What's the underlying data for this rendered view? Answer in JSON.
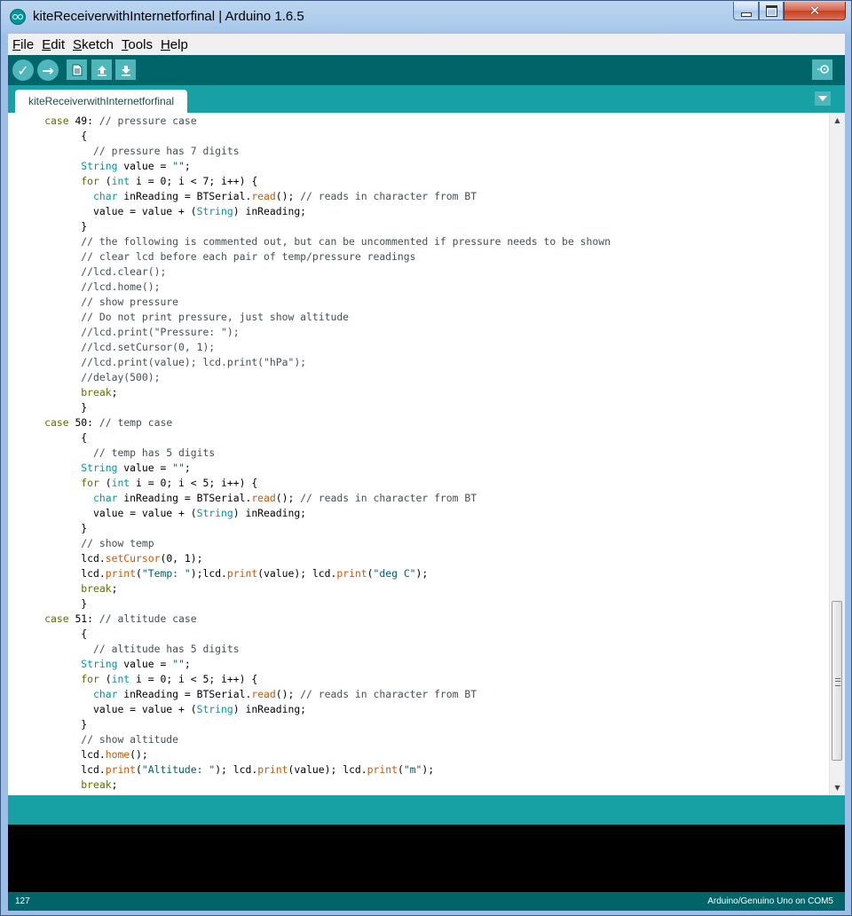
{
  "window": {
    "title": "kiteReceiverwithInternetforfinal | Arduino 1.6.5",
    "minimize_glyph": "",
    "maximize_glyph": "",
    "close_glyph": "✕"
  },
  "menu": {
    "items": [
      {
        "accel": "F",
        "rest": "ile"
      },
      {
        "accel": "E",
        "rest": "dit"
      },
      {
        "accel": "S",
        "rest": "ketch"
      },
      {
        "accel": "T",
        "rest": "ools"
      },
      {
        "accel": "H",
        "rest": "elp"
      }
    ]
  },
  "toolbar": {
    "verify_glyph": "✓",
    "upload_glyph": "→",
    "icons": [
      "verify-icon",
      "upload-icon",
      "new-icon",
      "open-icon",
      "save-icon",
      "serial-monitor-icon"
    ]
  },
  "tabs": {
    "active": "kiteReceiverwithInternetforfinal"
  },
  "editor": {
    "lines": [
      [
        [
          "      ",
          ""
        ],
        [
          "case",
          "kw"
        ],
        [
          " 49: ",
          ""
        ],
        [
          "// pressure case",
          "cm"
        ]
      ],
      [
        [
          "            {",
          ""
        ]
      ],
      [
        [
          "              ",
          ""
        ],
        [
          "// pressure has 7 digits",
          "cm"
        ]
      ],
      [
        [
          "            ",
          ""
        ],
        [
          "String",
          "ty"
        ],
        [
          " value = ",
          ""
        ],
        [
          "\"\"",
          "st"
        ],
        [
          ";",
          ""
        ]
      ],
      [
        [
          "            ",
          ""
        ],
        [
          "for",
          "kw"
        ],
        [
          " (",
          ""
        ],
        [
          "int",
          "ty"
        ],
        [
          " i = 0; i < 7; i++) {",
          ""
        ]
      ],
      [
        [
          "              ",
          ""
        ],
        [
          "char",
          "ty"
        ],
        [
          " inReading = BTSerial.",
          ""
        ],
        [
          "read",
          "fn"
        ],
        [
          "(); ",
          ""
        ],
        [
          "// reads in character from BT",
          "cm"
        ]
      ],
      [
        [
          "              value = value + (",
          ""
        ],
        [
          "String",
          "ty"
        ],
        [
          ") inReading;",
          ""
        ]
      ],
      [
        [
          "            }",
          ""
        ]
      ],
      [
        [
          "            ",
          ""
        ],
        [
          "// the following is commented out, but can be uncommented if pressure needs to be shown",
          "cm"
        ]
      ],
      [
        [
          "            ",
          ""
        ],
        [
          "// clear lcd before each pair of temp/pressure readings",
          "cm"
        ]
      ],
      [
        [
          "            ",
          ""
        ],
        [
          "//lcd.clear();",
          "cm"
        ]
      ],
      [
        [
          "            ",
          ""
        ],
        [
          "//lcd.home();",
          "cm"
        ]
      ],
      [
        [
          "            ",
          ""
        ],
        [
          "// show pressure",
          "cm"
        ]
      ],
      [
        [
          "            ",
          ""
        ],
        [
          "// Do not print pressure, just show altitude",
          "cm"
        ]
      ],
      [
        [
          "            ",
          ""
        ],
        [
          "//lcd.print(\"Pressure: \");",
          "cm"
        ]
      ],
      [
        [
          "            ",
          ""
        ],
        [
          "//lcd.setCursor(0, 1);",
          "cm"
        ]
      ],
      [
        [
          "            ",
          ""
        ],
        [
          "//lcd.print(value); lcd.print(\"hPa\");",
          "cm"
        ]
      ],
      [
        [
          "            ",
          ""
        ],
        [
          "//delay(500);",
          "cm"
        ]
      ],
      [
        [
          "            ",
          ""
        ],
        [
          "break",
          "kw"
        ],
        [
          ";",
          ""
        ]
      ],
      [
        [
          "            }",
          ""
        ]
      ],
      [
        [
          "      ",
          ""
        ],
        [
          "case",
          "kw"
        ],
        [
          " 50: ",
          ""
        ],
        [
          "// temp case",
          "cm"
        ]
      ],
      [
        [
          "            {",
          ""
        ]
      ],
      [
        [
          "              ",
          ""
        ],
        [
          "// temp has 5 digits",
          "cm"
        ]
      ],
      [
        [
          "            ",
          ""
        ],
        [
          "String",
          "ty"
        ],
        [
          " value = ",
          ""
        ],
        [
          "\"\"",
          "st"
        ],
        [
          ";",
          ""
        ]
      ],
      [
        [
          "            ",
          ""
        ],
        [
          "for",
          "kw"
        ],
        [
          " (",
          ""
        ],
        [
          "int",
          "ty"
        ],
        [
          " i = 0; i < 5; i++) {",
          ""
        ]
      ],
      [
        [
          "              ",
          ""
        ],
        [
          "char",
          "ty"
        ],
        [
          " inReading = BTSerial.",
          ""
        ],
        [
          "read",
          "fn"
        ],
        [
          "(); ",
          ""
        ],
        [
          "// reads in character from BT",
          "cm"
        ]
      ],
      [
        [
          "              value = value + (",
          ""
        ],
        [
          "String",
          "ty"
        ],
        [
          ") inReading;",
          ""
        ]
      ],
      [
        [
          "            }",
          ""
        ]
      ],
      [
        [
          "            ",
          ""
        ],
        [
          "// show temp",
          "cm"
        ]
      ],
      [
        [
          "            lcd.",
          ""
        ],
        [
          "setCursor",
          "fn"
        ],
        [
          "(0, 1);",
          ""
        ]
      ],
      [
        [
          "            lcd.",
          ""
        ],
        [
          "print",
          "fn"
        ],
        [
          "(",
          ""
        ],
        [
          "\"Temp: \"",
          "st"
        ],
        [
          ");lcd.",
          ""
        ],
        [
          "print",
          "fn"
        ],
        [
          "(value); lcd.",
          ""
        ],
        [
          "print",
          "fn"
        ],
        [
          "(",
          ""
        ],
        [
          "\"deg C\"",
          "st"
        ],
        [
          ");",
          ""
        ]
      ],
      [
        [
          "            ",
          ""
        ],
        [
          "break",
          "kw"
        ],
        [
          ";",
          ""
        ]
      ],
      [
        [
          "            }",
          ""
        ]
      ],
      [
        [
          "      ",
          ""
        ],
        [
          "case",
          "kw"
        ],
        [
          " 51: ",
          ""
        ],
        [
          "// altitude case",
          "cm"
        ]
      ],
      [
        [
          "            {",
          ""
        ]
      ],
      [
        [
          "              ",
          ""
        ],
        [
          "// altitude has 5 digits",
          "cm"
        ]
      ],
      [
        [
          "            ",
          ""
        ],
        [
          "String",
          "ty"
        ],
        [
          " value = ",
          ""
        ],
        [
          "\"\"",
          "st"
        ],
        [
          ";",
          ""
        ]
      ],
      [
        [
          "            ",
          ""
        ],
        [
          "for",
          "kw"
        ],
        [
          " (",
          ""
        ],
        [
          "int",
          "ty"
        ],
        [
          " i = 0; i < 5; i++) {",
          ""
        ]
      ],
      [
        [
          "              ",
          ""
        ],
        [
          "char",
          "ty"
        ],
        [
          " inReading = BTSerial.",
          ""
        ],
        [
          "read",
          "fn"
        ],
        [
          "(); ",
          ""
        ],
        [
          "// reads in character from BT",
          "cm"
        ]
      ],
      [
        [
          "              value = value + (",
          ""
        ],
        [
          "String",
          "ty"
        ],
        [
          ") inReading;",
          ""
        ]
      ],
      [
        [
          "            }",
          ""
        ]
      ],
      [
        [
          "            ",
          ""
        ],
        [
          "// show altitude",
          "cm"
        ]
      ],
      [
        [
          "            lcd.",
          ""
        ],
        [
          "home",
          "fn"
        ],
        [
          "();",
          ""
        ]
      ],
      [
        [
          "            lcd.",
          ""
        ],
        [
          "print",
          "fn"
        ],
        [
          "(",
          ""
        ],
        [
          "\"Altitude: \"",
          "st"
        ],
        [
          "); lcd.",
          ""
        ],
        [
          "print",
          "fn"
        ],
        [
          "(value); lcd.",
          ""
        ],
        [
          "print",
          "fn"
        ],
        [
          "(",
          ""
        ],
        [
          "\"m\"",
          "st"
        ],
        [
          ");",
          ""
        ]
      ],
      [
        [
          "            ",
          ""
        ],
        [
          "break",
          "kw"
        ],
        [
          ";",
          ""
        ]
      ]
    ]
  },
  "scrollbar": {
    "up_glyph": "▲",
    "down_glyph": "▼"
  },
  "status": {
    "line_number": "127",
    "board": "Arduino/Genuino Uno on COM5"
  },
  "colors": {
    "toolbar": "#006468",
    "tabbar": "#17a1a5",
    "keyword": "#5e6d03",
    "type": "#00979c",
    "function": "#d35400",
    "comment": "#434f54"
  }
}
